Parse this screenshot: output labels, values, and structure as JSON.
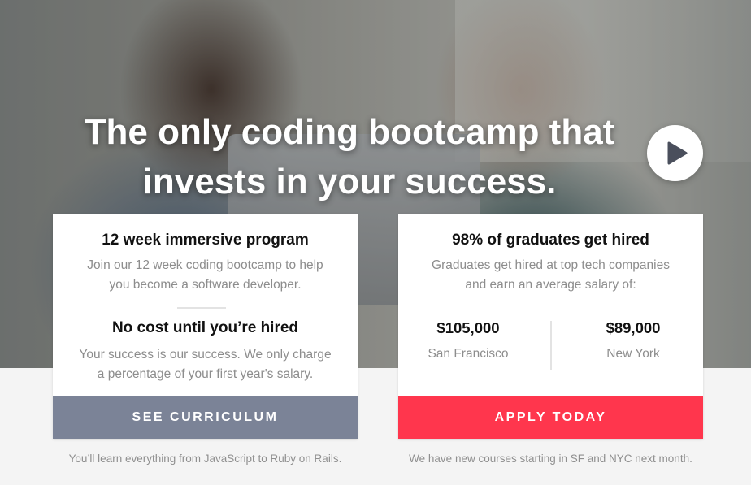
{
  "hero": {
    "headline_line1": "The only coding bootcamp that",
    "headline_line2": "invests in your success.",
    "play_icon": "play-icon"
  },
  "left_card": {
    "title1": "12 week immersive program",
    "text1": "Join our 12 week coding bootcamp to help you become a software developer.",
    "title2": "No cost until you’re hired",
    "text2": "Your success is our success. We only charge a percentage of your first year's salary.",
    "button": "SEE CURRICULUM",
    "note": "You’ll learn everything from JavaScript to Ruby on Rails."
  },
  "right_card": {
    "title": "98% of graduates get hired",
    "text": "Graduates get hired at top tech companies and earn an average salary of:",
    "stats": [
      {
        "value": "$105,000",
        "label": "San Francisco"
      },
      {
        "value": "$89,000",
        "label": "New York"
      }
    ],
    "button": "APPLY TODAY",
    "note": "We have new courses starting in SF and NYC next month."
  },
  "colors": {
    "gray_button": "#7b8397",
    "red_button": "#ff364d",
    "play_triangle": "#4a4f5c"
  }
}
